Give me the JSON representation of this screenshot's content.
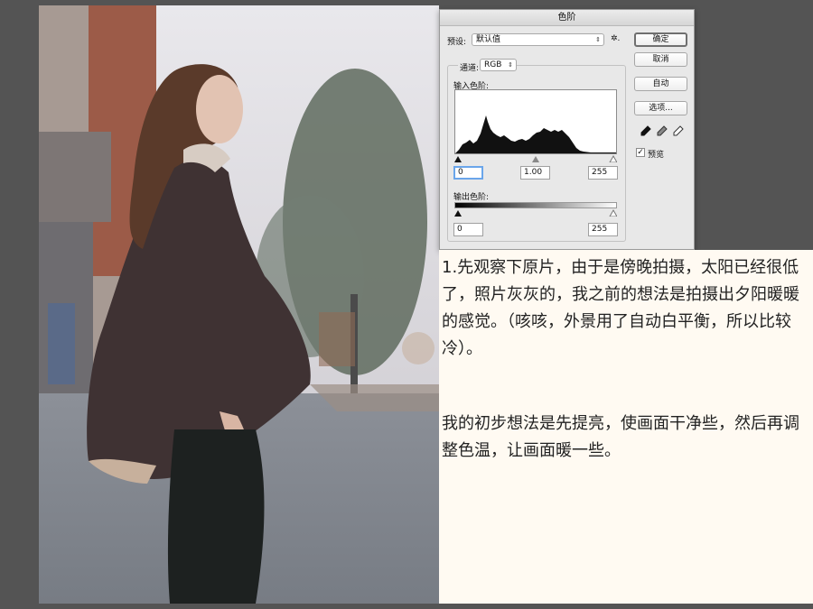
{
  "dialog": {
    "title": "色阶",
    "preset_label": "预设:",
    "preset_value": "默认值",
    "preset_gear": "✲.",
    "channel_label": "通道:",
    "channel_value": "RGB",
    "input_levels_label": "输入色阶:",
    "output_levels_label": "输出色阶:",
    "input_black": "0",
    "input_gamma": "1.00",
    "input_white": "255",
    "output_black": "0",
    "output_white": "255",
    "buttons": {
      "ok": "确定",
      "cancel": "取消",
      "auto": "自动",
      "options": "选项..."
    },
    "preview_label": "预览",
    "preview_checked": true,
    "eyedropper_icons": [
      "black-point-eyedropper-icon",
      "gray-point-eyedropper-icon",
      "white-point-eyedropper-icon"
    ]
  },
  "article": {
    "paragraph_1": "1.先观察下原片，由于是傍晚拍摄，太阳已经很低了，照片灰灰的，我之前的想法是拍摄出夕阳暖暖的感觉。（咳咳，外景用了自动白平衡，所以比较冷）。",
    "paragraph_2": "我的初步想法是先提亮，使画面干净些，然后再调整色温，让画面暖一些。"
  },
  "colors": {
    "background": "#545454",
    "panel": "#fffaf2",
    "focus": "#6aa5ea"
  }
}
